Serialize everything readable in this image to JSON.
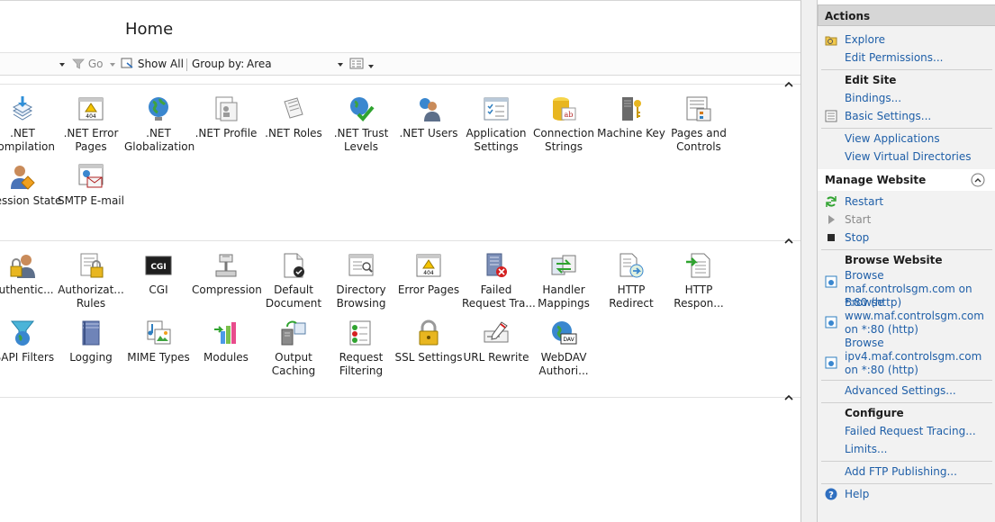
{
  "main": {
    "title": "Home",
    "toolbar": {
      "go_label": "Go",
      "show_all_label": "Show All",
      "group_by_label": "Group by:",
      "group_by_value": "Area"
    },
    "sections": [
      {
        "items": [
          {
            "label": ".NET\nCompilation",
            "icon": "dotnet-compilation-icon"
          },
          {
            "label": ".NET Error\nPages",
            "icon": "dotnet-error-pages-icon"
          },
          {
            "label": ".NET\nGlobalization",
            "icon": "globe-icon"
          },
          {
            "label": ".NET Profile",
            "icon": "dotnet-profile-icon"
          },
          {
            "label": ".NET Roles",
            "icon": "dotnet-roles-icon"
          },
          {
            "label": ".NET Trust\nLevels",
            "icon": "trust-levels-icon"
          },
          {
            "label": ".NET Users",
            "icon": "users-icon"
          },
          {
            "label": "Application\nSettings",
            "icon": "application-settings-icon"
          },
          {
            "label": "Connection\nStrings",
            "icon": "connection-strings-icon"
          },
          {
            "label": "Machine Key",
            "icon": "machine-key-icon"
          },
          {
            "label": "Pages and\nControls",
            "icon": "pages-controls-icon"
          },
          {
            "label": "Session State",
            "icon": "session-state-icon"
          },
          {
            "label": "SMTP E-mail",
            "icon": "smtp-email-icon"
          }
        ]
      },
      {
        "items": [
          {
            "label": "Authentic...",
            "icon": "authentication-icon"
          },
          {
            "label": "Authorizat...\nRules",
            "icon": "authorization-rules-icon"
          },
          {
            "label": "CGI",
            "icon": "cgi-icon"
          },
          {
            "label": "Compression",
            "icon": "compression-icon"
          },
          {
            "label": "Default\nDocument",
            "icon": "default-document-icon"
          },
          {
            "label": "Directory\nBrowsing",
            "icon": "directory-browsing-icon"
          },
          {
            "label": "Error Pages",
            "icon": "error-pages-icon"
          },
          {
            "label": "Failed\nRequest Tra...",
            "icon": "failed-request-tracing-icon"
          },
          {
            "label": "Handler\nMappings",
            "icon": "handler-mappings-icon"
          },
          {
            "label": "HTTP\nRedirect",
            "icon": "http-redirect-icon"
          },
          {
            "label": "HTTP\nRespon...",
            "icon": "http-response-headers-icon"
          },
          {
            "label": "ISAPI Filters",
            "icon": "isapi-filters-icon"
          },
          {
            "label": "Logging",
            "icon": "logging-icon"
          },
          {
            "label": "MIME Types",
            "icon": "mime-types-icon"
          },
          {
            "label": "Modules",
            "icon": "modules-icon"
          },
          {
            "label": "Output\nCaching",
            "icon": "output-caching-icon"
          },
          {
            "label": "Request\nFiltering",
            "icon": "request-filtering-icon"
          },
          {
            "label": "SSL Settings",
            "icon": "ssl-lock-icon"
          },
          {
            "label": "URL Rewrite",
            "icon": "url-rewrite-icon"
          },
          {
            "label": "WebDAV\nAuthori...",
            "icon": "webdav-icon"
          }
        ]
      }
    ]
  },
  "actions": {
    "header": "Actions",
    "explore": "Explore",
    "edit_permissions": "Edit Permissions...",
    "edit_site_title": "Edit Site",
    "bindings": "Bindings...",
    "basic_settings": "Basic Settings...",
    "view_applications": "View Applications",
    "view_virtual_directories": "View Virtual Directories",
    "manage_website_title": "Manage Website",
    "restart": "Restart",
    "start": "Start",
    "stop": "Stop",
    "browse_website_title": "Browse Website",
    "browse_1": "Browse maf.controlsgm.com on *:80 (http)",
    "browse_2": "Browse www.maf.controlsgm.com on *:80 (http)",
    "browse_3": "Browse ipv4.maf.controlsgm.com on *:80 (http)",
    "advanced_settings": "Advanced Settings...",
    "configure_title": "Configure",
    "failed_request_tracing": "Failed Request Tracing...",
    "limits": "Limits...",
    "add_ftp_publishing": "Add FTP Publishing...",
    "help": "Help"
  }
}
